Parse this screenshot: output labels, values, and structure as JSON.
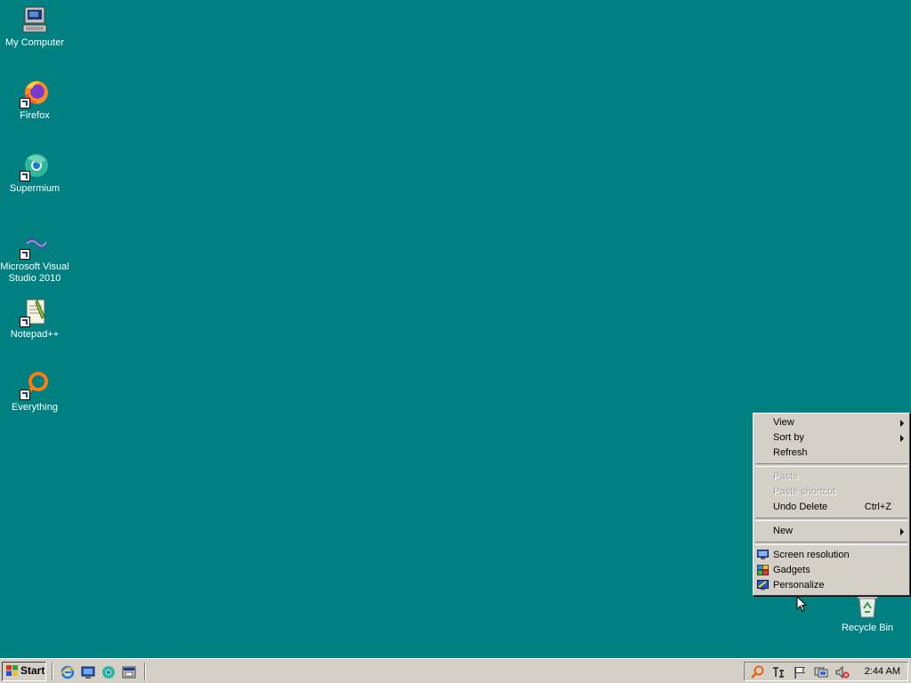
{
  "desktop": {
    "background_color": "#008080",
    "icons": [
      {
        "label": "My Computer",
        "icon": "computer-icon"
      },
      {
        "label": "Firefox",
        "icon": "firefox-icon"
      },
      {
        "label": "Supermium",
        "icon": "supermium-icon"
      },
      {
        "label": "Microsoft Visual Studio 2010",
        "label_line1": "Microsoft Visual",
        "label_line2": "Studio 2010",
        "icon": "visual-studio-icon"
      },
      {
        "label": "Notepad++",
        "icon": "notepadpp-icon"
      },
      {
        "label": "Everything",
        "icon": "everything-search-icon"
      },
      {
        "label": "Recycle Bin",
        "icon": "recycle-bin-icon"
      }
    ]
  },
  "context_menu": {
    "items": [
      {
        "label": "View",
        "submenu": true
      },
      {
        "label": "Sort by",
        "submenu": true
      },
      {
        "label": "Refresh"
      },
      {
        "label": "Paste",
        "disabled": true
      },
      {
        "label": "Paste shortcut",
        "disabled": true
      },
      {
        "label": "Undo Delete",
        "shortcut": "Ctrl+Z"
      },
      {
        "label": "New",
        "submenu": true
      },
      {
        "label": "Screen resolution",
        "icon": "monitor-icon"
      },
      {
        "label": "Gadgets",
        "icon": "gadgets-icon"
      },
      {
        "label": "Personalize",
        "icon": "personalize-icon"
      }
    ]
  },
  "taskbar": {
    "start_label": "Start",
    "quick_launch": [
      "internet-explorer-icon",
      "show-desktop-icon",
      "supermium-icon",
      "switch-windows-icon"
    ],
    "tray_icons": [
      "search-icon",
      "language-bar-icon",
      "action-center-flag-icon",
      "network-icon",
      "volume-muted-icon"
    ],
    "clock": "2:44 AM"
  }
}
